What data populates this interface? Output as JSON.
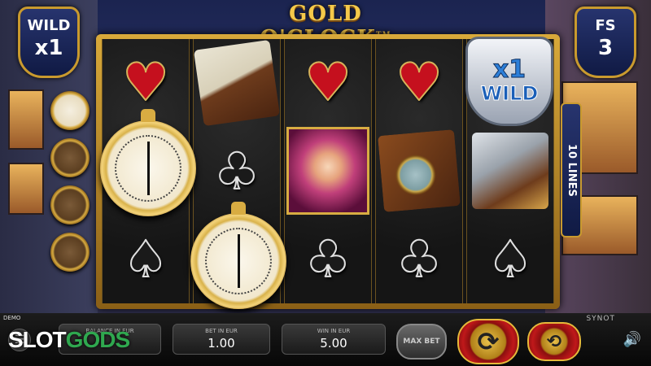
{
  "game": {
    "title": "GOLD O'CLOCK",
    "trademark": "TM"
  },
  "badges": {
    "wild_label": "WILD",
    "wild_multiplier": "x1",
    "fs_label": "FS",
    "fs_count": "3"
  },
  "lines_label": "10 LINES",
  "reels": [
    [
      "heart",
      "gold-pocket-watch",
      "spade"
    ],
    [
      "notebook",
      "club",
      "gold-pocket-watch"
    ],
    [
      "heart",
      "lady-portrait",
      "club"
    ],
    [
      "heart",
      "magnifying-glass",
      "club"
    ],
    [
      "x1-wild-badge",
      "revolver",
      "spade"
    ]
  ],
  "wild_symbol": {
    "multiplier": "x1",
    "label": "WILD"
  },
  "hud": {
    "demo_label": "DEMO",
    "provider": "SYNOT",
    "balance_label": "BALANCE IN EUR",
    "bet_label": "BET IN EUR",
    "bet_value": "1.00",
    "win_label": "WIN IN EUR",
    "win_value": "5.00",
    "max_bet_label": "MAX BET"
  },
  "watermark": {
    "prefix": "SLOT",
    "suffix": "GODS"
  }
}
